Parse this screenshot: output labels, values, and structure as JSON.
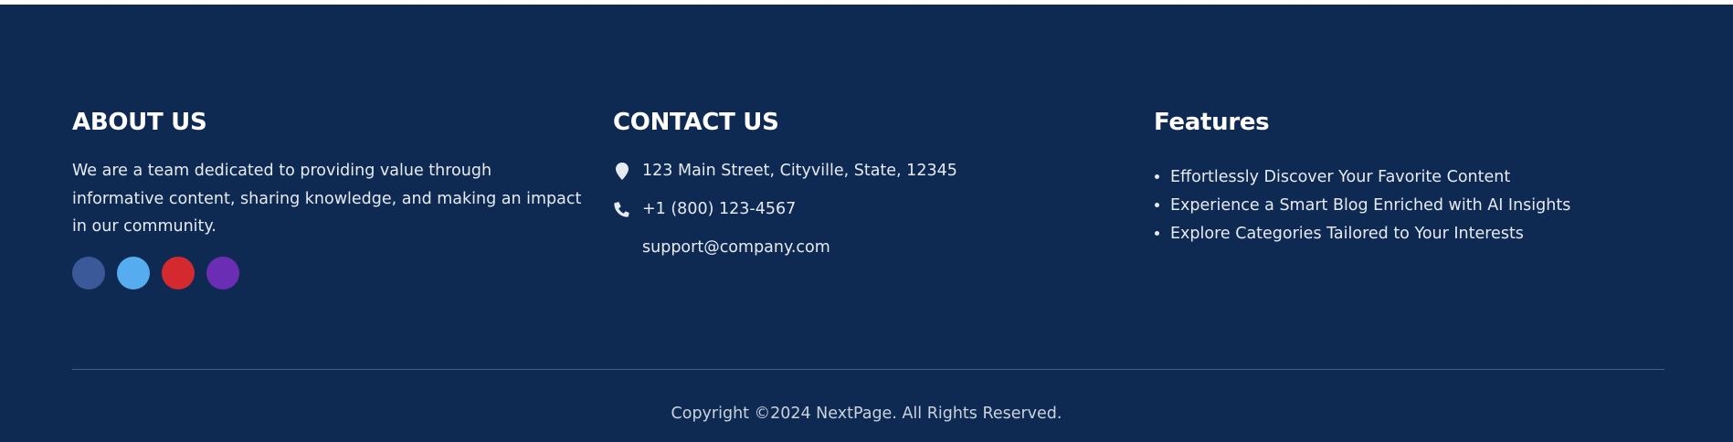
{
  "about": {
    "heading": "ABOUT US",
    "text": "We are a team dedicated to providing value through informative content, sharing knowledge, and making an impact in our community.",
    "social": [
      {
        "icon": "facebook-icon",
        "color": "#3b5998"
      },
      {
        "icon": "twitter-icon",
        "color": "#55acee"
      },
      {
        "icon": "youtube-icon",
        "color": "#d42a2f"
      },
      {
        "icon": "instagram-icon",
        "color": "#6c2db5"
      }
    ]
  },
  "contact": {
    "heading": "CONTACT US",
    "address": "123 Main Street, Cityville, State, 12345",
    "phone": "+1 (800) 123-4567",
    "email": "support@company.com"
  },
  "features": {
    "heading": "Features",
    "items": [
      "Effortlessly Discover Your Favorite Content",
      "Experience a Smart Blog Enriched with AI Insights",
      "Explore Categories Tailored to Your Interests"
    ]
  },
  "footer": {
    "copyright": "Copyright ©2024 NextPage. All Rights Reserved."
  },
  "colors": {
    "background": "#0f2a52",
    "text": "#e6ebf3",
    "divider": "#4a5f80"
  }
}
